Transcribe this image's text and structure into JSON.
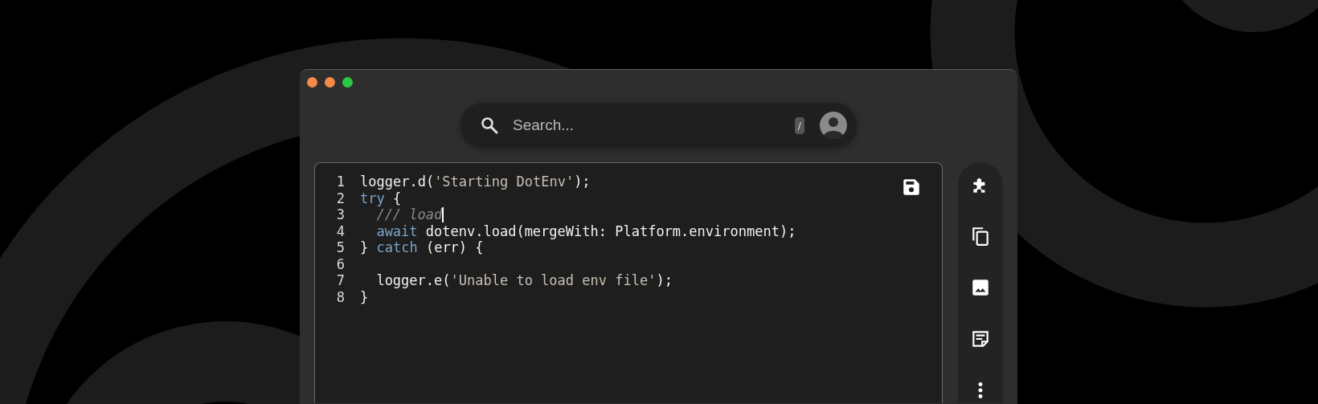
{
  "window": {
    "controls": [
      {
        "color": "#f5894a"
      },
      {
        "color": "#f5894a"
      },
      {
        "color": "#2ac840"
      }
    ]
  },
  "search": {
    "placeholder": "Search...",
    "shortcut": "/"
  },
  "editor": {
    "lines": [
      {
        "number": "1",
        "tokens": [
          {
            "kind": "plain",
            "text": "logger.d("
          },
          {
            "kind": "string",
            "text": "'Starting DotEnv'"
          },
          {
            "kind": "plain",
            "text": ");"
          }
        ]
      },
      {
        "number": "2",
        "tokens": [
          {
            "kind": "keyword",
            "text": "try"
          },
          {
            "kind": "plain",
            "text": " {"
          }
        ]
      },
      {
        "number": "3",
        "cursor": true,
        "indented": true,
        "tokens": [
          {
            "kind": "comment",
            "text": "/// load"
          }
        ]
      },
      {
        "number": "4",
        "indented": true,
        "tokens": [
          {
            "kind": "keyword",
            "text": "await"
          },
          {
            "kind": "plain",
            "text": " dotenv.load(mergeWith: Platform.environment);"
          }
        ]
      },
      {
        "number": "5",
        "tokens": [
          {
            "kind": "plain",
            "text": "} "
          },
          {
            "kind": "keyword",
            "text": "catch"
          },
          {
            "kind": "plain",
            "text": " (err) {"
          }
        ]
      },
      {
        "number": "6"
      },
      {
        "number": "7",
        "indented": true,
        "tokens": [
          {
            "kind": "plain",
            "text": "logger.e("
          },
          {
            "kind": "string",
            "text": "'Unable to load env file'"
          },
          {
            "kind": "plain",
            "text": ");"
          }
        ]
      },
      {
        "number": "8",
        "tokens": [
          {
            "kind": "plain",
            "text": "}"
          }
        ]
      }
    ]
  },
  "sidebar": {
    "items": [
      {
        "kind": "puzzle"
      },
      {
        "kind": "copy"
      },
      {
        "kind": "image"
      },
      {
        "kind": "note"
      },
      {
        "kind": "more"
      }
    ]
  }
}
